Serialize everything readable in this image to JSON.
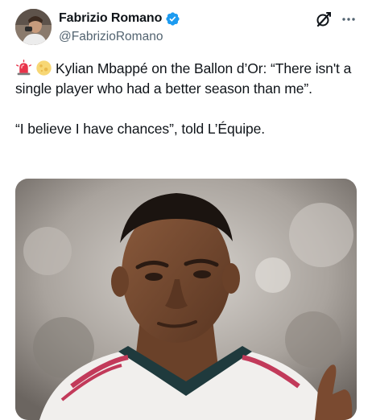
{
  "tweet": {
    "author": {
      "display_name": "Fabrizio Romano",
      "handle": "@FabrizioRomano",
      "verified": true,
      "avatar_icon": "avatar-photo"
    },
    "actions": {
      "grok_icon": "grok-icon",
      "more_icon": "more-dots-icon"
    },
    "text_lead_emojis": [
      "siren-emoji",
      "full-moon-emoji"
    ],
    "text": "Kylian Mbappé on the Ballon d’Or: “There isn't a single player who had a better season than me”.\n\n“I believe I have chances”, told L’Équipe.",
    "media": {
      "type": "photo",
      "description_icon": "player-photo"
    },
    "colors": {
      "text": "#0f1419",
      "secondary": "#536471",
      "verified_badge": "#1d9bf0"
    }
  }
}
